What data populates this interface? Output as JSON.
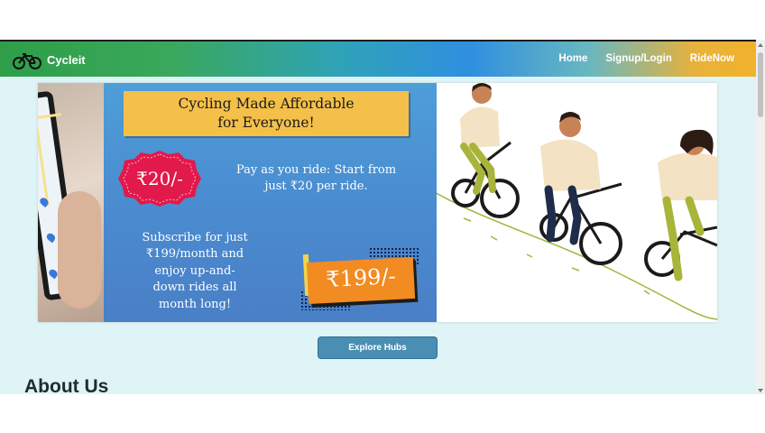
{
  "brand": {
    "name": "Cycleit",
    "icon": "bicycle-icon"
  },
  "nav": {
    "links": [
      "Home",
      "Signup/Login",
      "RideNow"
    ]
  },
  "hero": {
    "tagline_line1": "Cycling Made Affordable",
    "tagline_line2": "for Everyone!",
    "price_badge": "₹20/-",
    "pay_line1": "Pay as you ride: Start from",
    "pay_line2": "just ₹20 per ride.",
    "subscribe_lines": [
      "Subscribe for just",
      "₹199/month and",
      "enjoy up-and-",
      "down rides all",
      "month long!"
    ],
    "subscription_price": "₹199/-"
  },
  "explore_button": "Explore Hubs",
  "about_heading": "About Us",
  "colors": {
    "nav_gradient_start": "#2e9e4a",
    "nav_gradient_end": "#f1b12c",
    "hero_blue": "#4a8cd0",
    "badge_red": "#e2194b",
    "tag_orange": "#f28b22",
    "banner_yellow": "#f4c04a",
    "button": "#4a8fb3",
    "page_bg": "#dff4f6"
  }
}
